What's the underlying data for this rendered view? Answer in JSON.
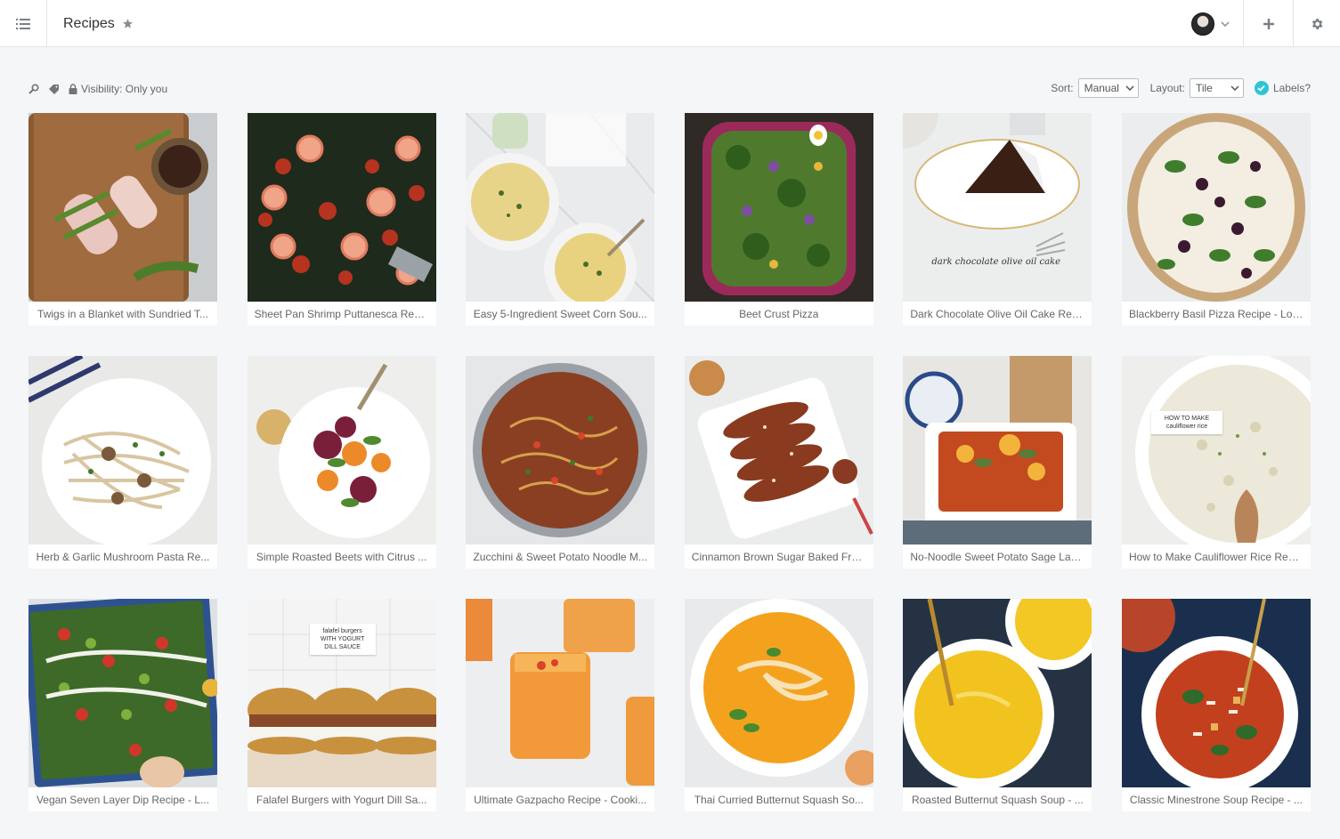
{
  "header": {
    "title": "Recipes",
    "icons": {
      "menu": "list-icon",
      "favorite": "star-icon",
      "add": "plus-icon",
      "settings": "gear-icon",
      "profile": "avatar"
    }
  },
  "toolbar": {
    "visibility_label": "Visibility: Only you",
    "sort_label": "Sort:",
    "sort_value": "Manual",
    "layout_label": "Layout:",
    "layout_value": "Tile",
    "labels_label": "Labels?",
    "labels_checked": true,
    "accent_color": "#2ec4d6"
  },
  "cards": [
    {
      "caption": "Twigs in a Blanket with Sundried T...",
      "overlay": ""
    },
    {
      "caption": "Sheet Pan Shrimp Puttanesca Reci...",
      "overlay": ""
    },
    {
      "caption": "Easy 5-Ingredient Sweet Corn Sou...",
      "overlay": ""
    },
    {
      "caption": "Beet Crust Pizza",
      "overlay": ""
    },
    {
      "caption": "Dark Chocolate Olive Oil Cake Reci...",
      "overlay": "dark chocolate olive oil cake"
    },
    {
      "caption": "Blackberry Basil Pizza Recipe - Lov...",
      "overlay": ""
    },
    {
      "caption": "Herb & Garlic Mushroom Pasta Re...",
      "overlay": ""
    },
    {
      "caption": "Simple Roasted Beets with Citrus ...",
      "overlay": ""
    },
    {
      "caption": "Zucchini & Sweet Potato Noodle M...",
      "overlay": ""
    },
    {
      "caption": "Cinnamon Brown Sugar Baked Fre...",
      "overlay": ""
    },
    {
      "caption": "No-Noodle Sweet Potato Sage Las...",
      "overlay": ""
    },
    {
      "caption": "How to Make Cauliflower Rice Reci...",
      "overlay": "HOW TO MAKE cauliflower rice"
    },
    {
      "caption": "Vegan Seven Layer Dip Recipe - L...",
      "overlay": ""
    },
    {
      "caption": "Falafel Burgers with Yogurt Dill Sa...",
      "overlay": "falafel burgers WITH YOGURT DILL SAUCE"
    },
    {
      "caption": "Ultimate Gazpacho Recipe - Cooki...",
      "overlay": ""
    },
    {
      "caption": "Thai Curried Butternut Squash So...",
      "overlay": ""
    },
    {
      "caption": "Roasted Butternut Squash Soup - ...",
      "overlay": ""
    },
    {
      "caption": "Classic Minestrone Soup Recipe - ...",
      "overlay": ""
    }
  ]
}
